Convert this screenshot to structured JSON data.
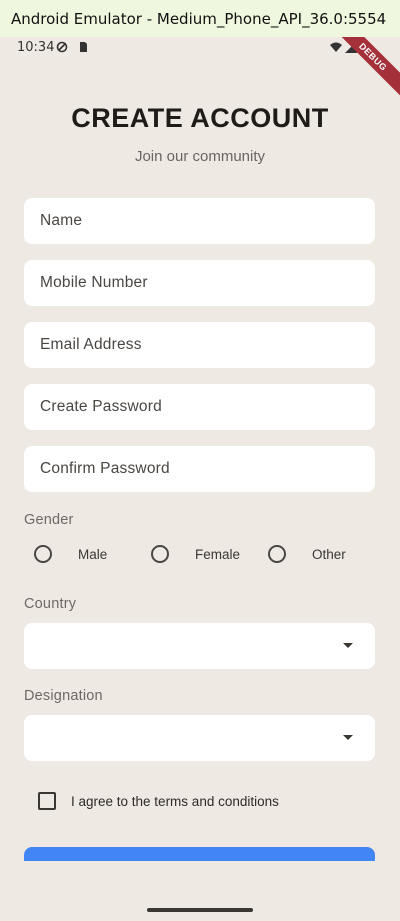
{
  "window": {
    "title": "Android Emulator - Medium_Phone_API_36.0:5554"
  },
  "status_bar": {
    "time": "10:34",
    "debug_label": "DEBUG"
  },
  "header": {
    "title": "CREATE ACCOUNT",
    "subtitle": "Join our community"
  },
  "form": {
    "fields": [
      {
        "label": "Name",
        "value": ""
      },
      {
        "label": "Mobile Number",
        "value": ""
      },
      {
        "label": "Email Address",
        "value": ""
      },
      {
        "label": "Create Password",
        "value": ""
      },
      {
        "label": "Confirm Password",
        "value": ""
      }
    ],
    "gender": {
      "label": "Gender",
      "options": [
        "Male",
        "Female",
        "Other"
      ],
      "selected": null
    },
    "country": {
      "label": "Country",
      "value": ""
    },
    "designation": {
      "label": "Designation",
      "value": ""
    },
    "terms": {
      "label": "I agree to the terms and conditions",
      "checked": false
    }
  },
  "colors": {
    "background": "#efe9e3",
    "field": "#ffffff",
    "accent": "#4285f4",
    "debug_banner": "#a6303a",
    "title_bar": "#eff8df"
  }
}
